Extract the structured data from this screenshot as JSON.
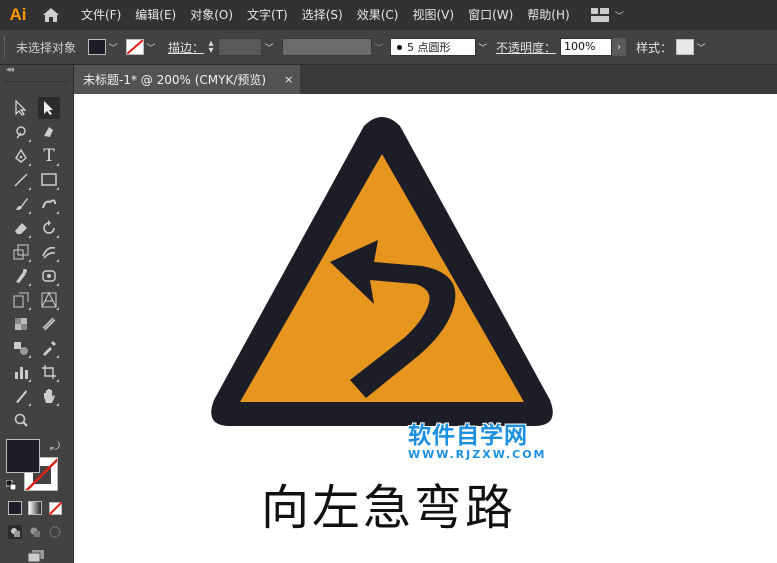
{
  "app": {
    "logo": "Ai"
  },
  "menu": [
    "文件(F)",
    "编辑(E)",
    "对象(O)",
    "文字(T)",
    "选择(S)",
    "效果(C)",
    "视图(V)",
    "窗口(W)",
    "帮助(H)"
  ],
  "control_bar": {
    "selection_label": "未选择对象",
    "stroke_label": "描边：",
    "brush_value": "5 点圆形",
    "opacity_label": "不透明度：",
    "opacity_value": "100%",
    "style_label": "样式："
  },
  "document_tab": {
    "title": "未标题-1* @ 200% (CMYK/预览)",
    "close": "×"
  },
  "toolbar": {
    "collapse": "◂◂"
  },
  "canvas": {
    "caption": "向左急弯路",
    "watermark_title": "软件自学网",
    "watermark_url": "WWW.RJZXW.COM"
  },
  "colors": {
    "sign_border": "#1c1d27",
    "sign_fill": "#e6951f",
    "fill_swatch": "#1c1d27",
    "watermark": "#1b8fe0",
    "logo": "#ff9a00"
  },
  "icons": [
    "home-icon",
    "workspace-icon",
    "selection-tool-icon",
    "direct-selection-tool-icon",
    "pen-tool-icon",
    "type-tool-icon",
    "rectangle-tool-icon",
    "zoom-tool-icon",
    "hand-tool-icon"
  ]
}
